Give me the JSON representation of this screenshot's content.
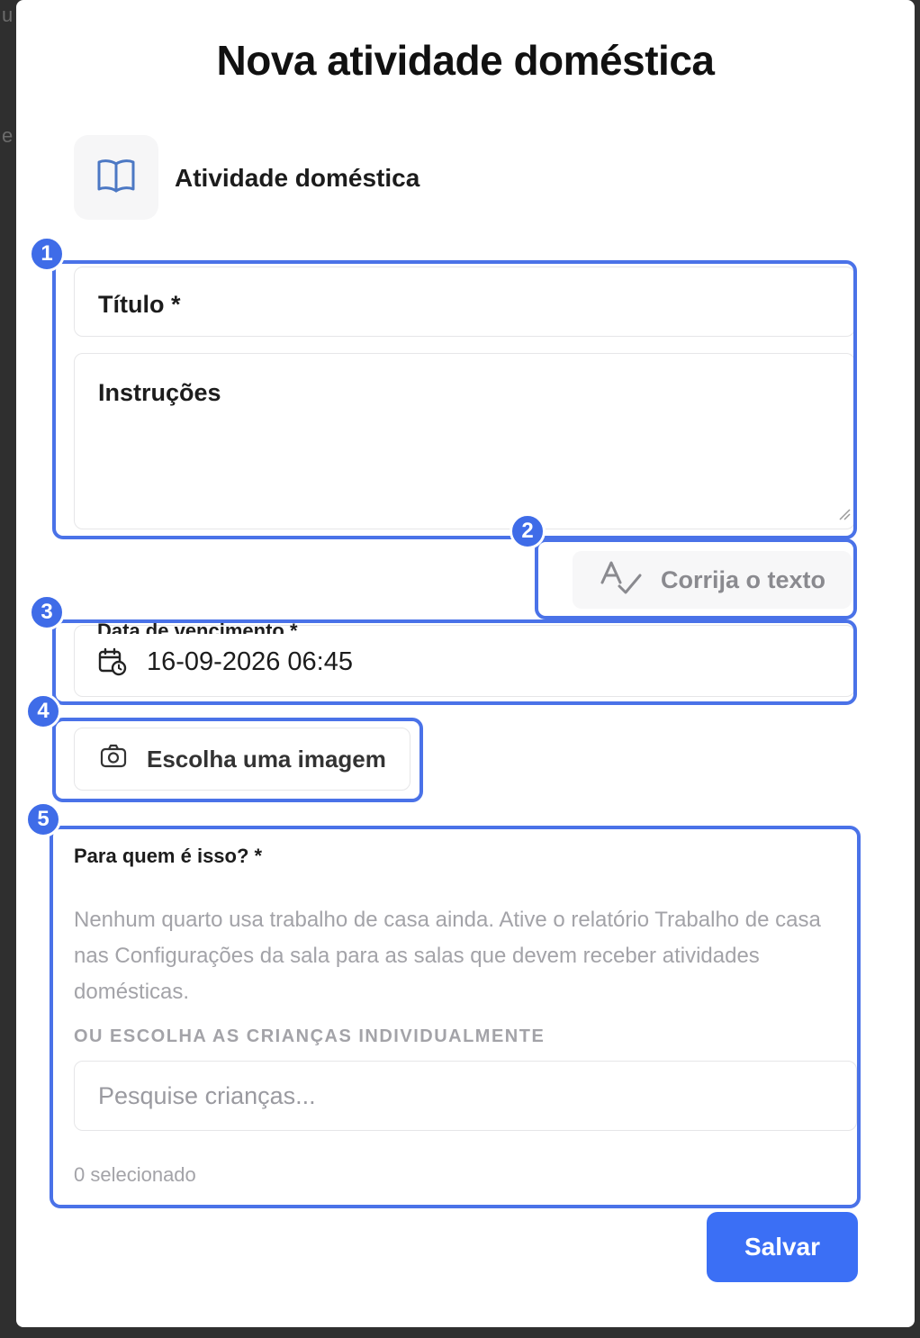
{
  "background_edge": {
    "top_char": "u",
    "mid_char": "e"
  },
  "modal": {
    "title": "Nova atividade doméstica",
    "activity_type": {
      "icon": "book-icon",
      "label": "Atividade doméstica"
    },
    "form": {
      "title_label": "Título *",
      "instructions_label": "Instruções",
      "fix_text_label": "Corrija o texto",
      "due_date_label": "Data de vencimento *",
      "due_date_value": "16-09-2026 06:45",
      "image_button_label": "Escolha uma imagem",
      "recipients": {
        "label": "Para quem é isso? *",
        "help_text": "Nenhum quarto usa trabalho de casa ainda. Ative o relatório Trabalho de casa nas Configurações da sala para as salas que devem receber atividades domésticas.",
        "individual_label": "OU ESCOLHA AS CRIANÇAS INDIVIDUALMENTE",
        "search_placeholder": "Pesquise crianças...",
        "selected_count": "0 selecionado"
      },
      "save_label": "Salvar"
    }
  },
  "annotations": [
    "1",
    "2",
    "3",
    "4",
    "5"
  ],
  "colors": {
    "accent": "#3b6ff5",
    "annotation": "#4a72e8",
    "backdrop": "#2f2f2f"
  }
}
